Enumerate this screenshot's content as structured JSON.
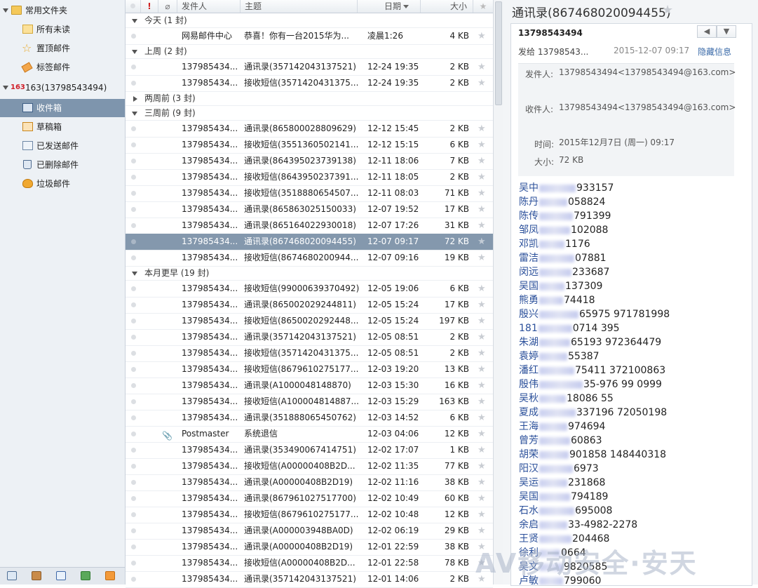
{
  "sidebar": {
    "fav_label": "常用文件夹",
    "unread_label": "所有未读",
    "pinned_label": "置顶邮件",
    "tagged_label": "标签邮件",
    "account_badge": "163",
    "account_label": "163(13798543494)",
    "inbox_label": "收件箱",
    "drafts_label": "草稿箱",
    "sent_label": "已发送邮件",
    "deleted_label": "已删除邮件",
    "junk_label": "垃圾邮件"
  },
  "list": {
    "col_flag": "!",
    "col_from": "发件人",
    "col_subject": "主题",
    "col_date": "日期",
    "col_size": "大小",
    "groups": {
      "g_today": "今天 (1 封)",
      "g_lastweek": "上周 (2 封)",
      "g_twoweeks": "两周前 (3 封)",
      "g_threeweeks": "三周前 (9 封)",
      "g_earlier": "本月更早 (19 封)"
    },
    "rows": [
      {
        "from": "网易邮件中心",
        "subject": "恭喜！你有一台2015华为...",
        "date": "凌晨1:26",
        "size": "4 KB"
      },
      {
        "from": "137985434...",
        "subject": "通讯录(357142043137521)",
        "date": "12-24 19:35",
        "size": "2 KB"
      },
      {
        "from": "137985434...",
        "subject": "接收短信(3571420431375...",
        "date": "12-24 19:35",
        "size": "2 KB"
      },
      {
        "from": "137985434...",
        "subject": "通讯录(865800028809629)",
        "date": "12-12 15:45",
        "size": "2 KB"
      },
      {
        "from": "137985434...",
        "subject": "接收短信(3551360502141...",
        "date": "12-12 15:15",
        "size": "6 KB"
      },
      {
        "from": "137985434...",
        "subject": "通讯录(864395023739138)",
        "date": "12-11 18:06",
        "size": "7 KB"
      },
      {
        "from": "137985434...",
        "subject": "接收短信(8643950237391...",
        "date": "12-11 18:05",
        "size": "2 KB"
      },
      {
        "from": "137985434...",
        "subject": "接收短信(3518880654507...",
        "date": "12-11 08:03",
        "size": "71 KB"
      },
      {
        "from": "137985434...",
        "subject": "通讯录(865863025150033)",
        "date": "12-07 19:52",
        "size": "17 KB"
      },
      {
        "from": "137985434...",
        "subject": "通讯录(865164022930018)",
        "date": "12-07 17:26",
        "size": "31 KB"
      },
      {
        "from": "137985434...",
        "subject": "通讯录(867468020094455)",
        "date": "12-07 09:17",
        "size": "72 KB"
      },
      {
        "from": "137985434...",
        "subject": "接收短信(8674680200944...",
        "date": "12-07 09:16",
        "size": "19 KB"
      },
      {
        "from": "137985434...",
        "subject": "接收短信(99000639370492)",
        "date": "12-05 19:06",
        "size": "6 KB"
      },
      {
        "from": "137985434...",
        "subject": "通讯录(865002029244811)",
        "date": "12-05 15:24",
        "size": "17 KB"
      },
      {
        "from": "137985434...",
        "subject": "接收短信(8650020292448...",
        "date": "12-05 15:24",
        "size": "197 KB"
      },
      {
        "from": "137985434...",
        "subject": "通讯录(357142043137521)",
        "date": "12-05 08:51",
        "size": "2 KB"
      },
      {
        "from": "137985434...",
        "subject": "接收短信(3571420431375...",
        "date": "12-05 08:51",
        "size": "2 KB"
      },
      {
        "from": "137985434...",
        "subject": "接收短信(8679610275177...",
        "date": "12-03 19:20",
        "size": "13 KB"
      },
      {
        "from": "137985434...",
        "subject": "通讯录(A1000048148870)",
        "date": "12-03 15:30",
        "size": "16 KB"
      },
      {
        "from": "137985434...",
        "subject": "接收短信(A100004814887...",
        "date": "12-03 15:29",
        "size": "163 KB"
      },
      {
        "from": "137985434...",
        "subject": "通讯录(351888065450762)",
        "date": "12-03 14:52",
        "size": "6 KB"
      },
      {
        "from": "Postmaster",
        "subject": "系统退信",
        "date": "12-03 04:06",
        "size": "12 KB"
      },
      {
        "from": "137985434...",
        "subject": "通讯录(353490067414751)",
        "date": "12-02 17:07",
        "size": "1 KB"
      },
      {
        "from": "137985434...",
        "subject": "接收短信(A00000408B2D...",
        "date": "12-02 11:35",
        "size": "77 KB"
      },
      {
        "from": "137985434...",
        "subject": "通讯录(A00000408B2D19)",
        "date": "12-02 11:16",
        "size": "38 KB"
      },
      {
        "from": "137985434...",
        "subject": "通讯录(867961027517700)",
        "date": "12-02 10:49",
        "size": "60 KB"
      },
      {
        "from": "137985434...",
        "subject": "接收短信(8679610275177...",
        "date": "12-02 10:48",
        "size": "12 KB"
      },
      {
        "from": "137985434...",
        "subject": "通讯录(A000003948BA0D)",
        "date": "12-02 06:19",
        "size": "29 KB"
      },
      {
        "from": "137985434...",
        "subject": "通讯录(A00000408B2D19)",
        "date": "12-01 22:59",
        "size": "38 KB"
      },
      {
        "from": "137985434...",
        "subject": "接收短信(A00000408B2D...",
        "date": "12-01 22:58",
        "size": "78 KB"
      },
      {
        "from": "137985434...",
        "subject": "通讯录(357142043137521)",
        "date": "12-01 14:06",
        "size": "2 KB"
      }
    ]
  },
  "reader": {
    "title": "通讯录(867468020094455)",
    "sender": "13798543494",
    "to_summary": "发给 13798543...",
    "time": "2015-12-07 09:17",
    "hide_info": "隐藏信息",
    "detail": {
      "from_label": "发件人:",
      "from_value": "13798543494<13798543494@163.com>",
      "to_label": "收件人:",
      "to_value": "13798543494<13798543494@163.com>",
      "time_label": "时间:",
      "time_value": "2015年12月7日 (周一) 09:17",
      "size_label": "大小:",
      "size_value": "72 KB"
    },
    "contacts": [
      {
        "name": "吴中",
        "number": "933157"
      },
      {
        "name": "陈丹",
        "number": "058824"
      },
      {
        "name": "陈传",
        "number": "791399"
      },
      {
        "name": "邹凤",
        "number": "102088"
      },
      {
        "name": "邓凯",
        "number": "1176"
      },
      {
        "name": "雷洁",
        "number": "07881"
      },
      {
        "name": "闵远",
        "number": "233687"
      },
      {
        "name": "吴国",
        "number": "137309"
      },
      {
        "name": "熊勇",
        "number": "74418"
      },
      {
        "name": "殷兴",
        "number": "65975 971781998"
      },
      {
        "name": "181",
        "number": "0714 395"
      },
      {
        "name": "朱湖",
        "number": "65193 972364479"
      },
      {
        "name": "袁婷",
        "number": "55387"
      },
      {
        "name": "潘红",
        "number": "75411 372100863"
      },
      {
        "name": "殷伟",
        "number": "35-976 99 0999"
      },
      {
        "name": "吴秋",
        "number": "18086 55"
      },
      {
        "name": "夏成",
        "number": "337196 72050198"
      },
      {
        "name": "王海",
        "number": "974694"
      },
      {
        "name": "曾芳",
        "number": "60863"
      },
      {
        "name": "胡荣",
        "number": "901858 148440318"
      },
      {
        "name": "阳汉",
        "number": "6973"
      },
      {
        "name": "吴运",
        "number": "231868"
      },
      {
        "name": "吴国",
        "number": "794189"
      },
      {
        "name": "石水",
        "number": "695008"
      },
      {
        "name": "余启",
        "number": "33-4982-2278"
      },
      {
        "name": "王贤",
        "number": "204468"
      },
      {
        "name": "徐利",
        "number": "0664"
      },
      {
        "name": "吴文",
        "number": "9820585"
      },
      {
        "name": "卢敏",
        "number": "799060"
      }
    ]
  },
  "watermark": "AV移动安全·安天"
}
